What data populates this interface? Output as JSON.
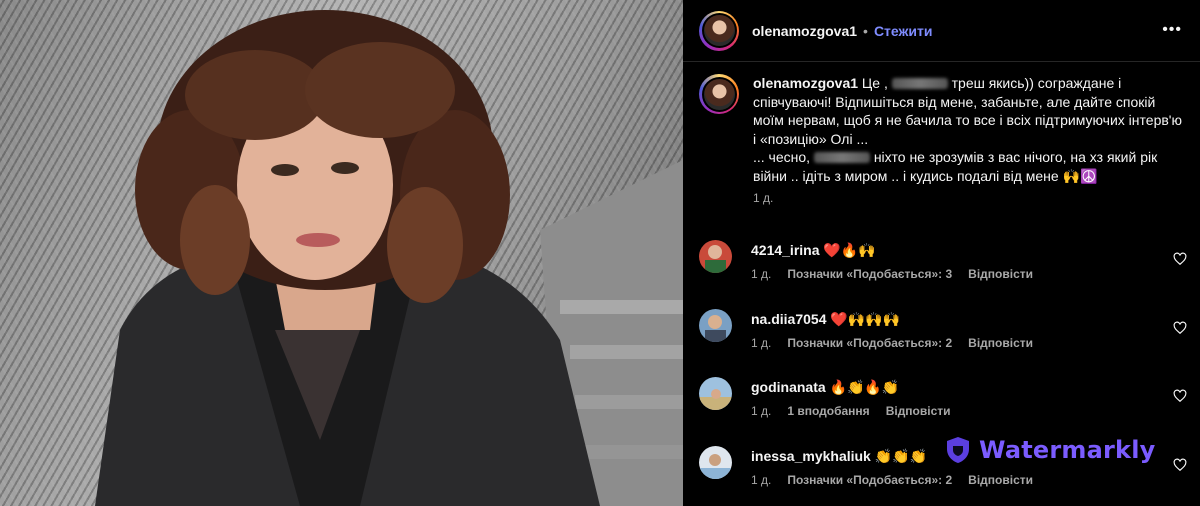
{
  "post": {
    "username": "olenamozgova1",
    "follow_label": "Стежити",
    "separator": "•",
    "more_label": "•••"
  },
  "caption": {
    "username": "olenamozgova1",
    "part1": " Це ,",
    "part2": " треш якись)) сограждане і співчуваючі! Відпишіться від мене, забаньте, але дайте спокій моїм нервам, щоб я не бачила то все і всіх підтримуючих інтерв'ю і «позицію» Олі ...\n... чесно,",
    "part3": " ніхто не зрозумів з вас нічого, на хз який рік війни .. ідіть з миром .. і кудись подалі від мене 🙌☮️",
    "time": "1 д."
  },
  "comments": [
    {
      "username": "4214_irina",
      "text": "❤️🔥🙌",
      "time": "1 д.",
      "likes": "Позначки «Подобається»: 3",
      "reply": "Відповісти"
    },
    {
      "username": "na.diia7054",
      "text": "❤️🙌🙌🙌",
      "time": "1 д.",
      "likes": "Позначки «Подобається»: 2",
      "reply": "Відповісти"
    },
    {
      "username": "godinanata",
      "text": "🔥👏🔥👏",
      "time": "1 д.",
      "likes": "1 вподобання",
      "reply": "Відповісти"
    },
    {
      "username": "inessa_mykhaliuk",
      "text": "👏👏👏",
      "time": "1 д.",
      "likes": "Позначки «Подобається»: 2",
      "reply": "Відповісти"
    }
  ],
  "watermark": {
    "text": "Watermarkly",
    "color": "#7b5cff"
  },
  "colors": {
    "follow": "#7f8cff",
    "secondary_text": "#a8a8a8",
    "background": "#000000"
  }
}
